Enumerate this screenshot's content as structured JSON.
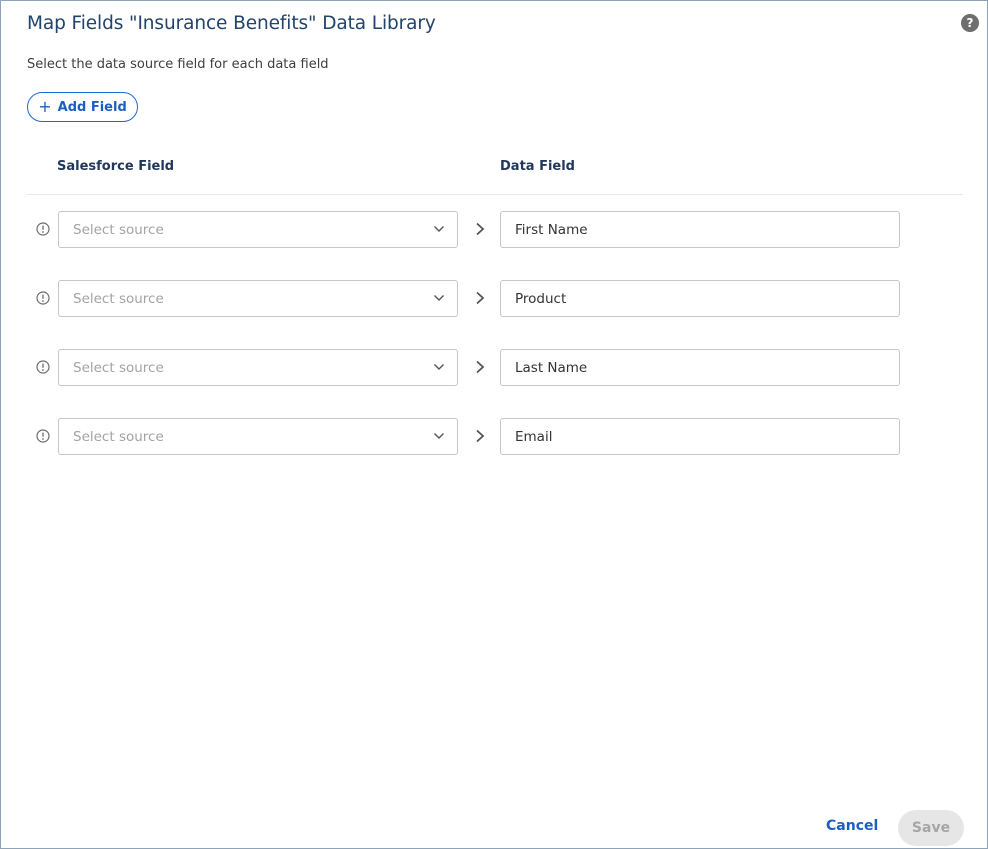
{
  "dialog": {
    "title": "Map Fields \"Insurance Benefits\" Data Library",
    "help_label": "?",
    "subtitle": "Select the data source field for each data field",
    "add_field_label": "Add Field",
    "add_field_icon": "+"
  },
  "columns": {
    "source_header": "Salesforce Field",
    "target_header": "Data Field"
  },
  "rows": [
    {
      "source_placeholder": "Select source",
      "data_field": "First Name"
    },
    {
      "source_placeholder": "Select source",
      "data_field": "Product"
    },
    {
      "source_placeholder": "Select source",
      "data_field": "Last Name"
    },
    {
      "source_placeholder": "Select source",
      "data_field": "Email"
    }
  ],
  "footer": {
    "cancel_label": "Cancel",
    "save_label": "Save",
    "save_enabled": false
  },
  "icons": {
    "row_status": "warning-circle-icon",
    "dropdown": "chevron-down-icon",
    "mapping": "chevron-right-icon",
    "help": "help-circle-icon"
  },
  "colors": {
    "title": "#22436b",
    "accent": "#1a60c0",
    "border": "#8fa3b8",
    "disabled_bg": "#e6e6e6"
  }
}
